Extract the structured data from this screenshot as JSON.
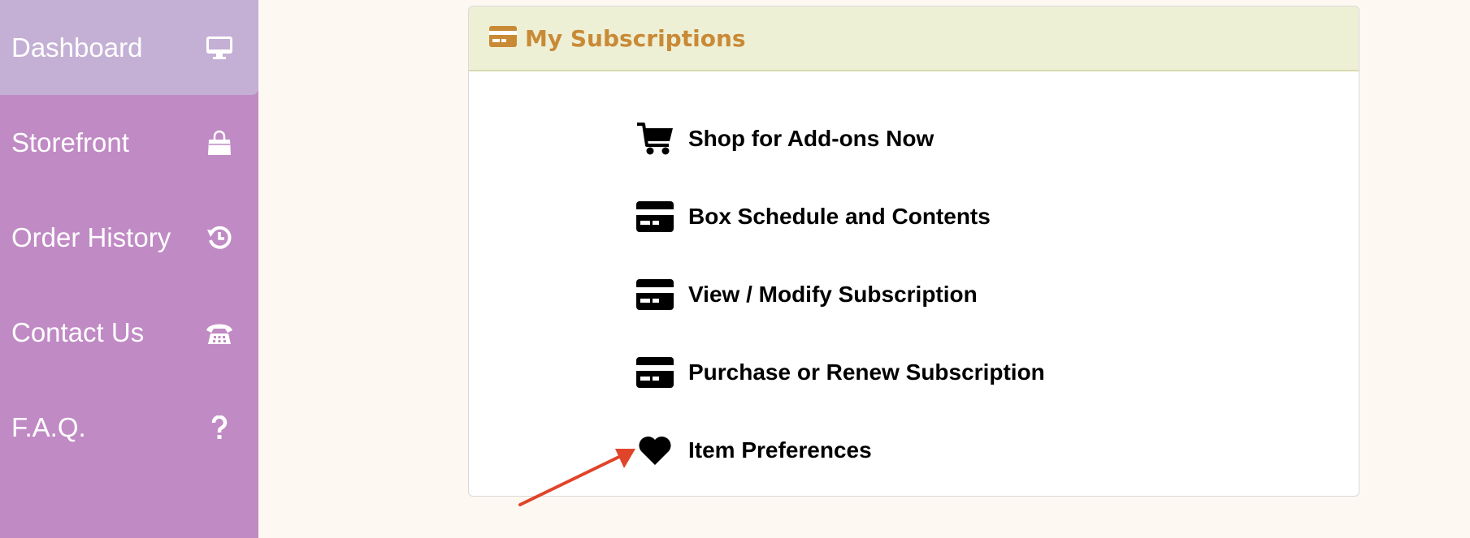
{
  "sidebar": {
    "items": [
      {
        "label": "Dashboard",
        "icon": "monitor-icon",
        "active": true
      },
      {
        "label": "Storefront",
        "icon": "shopping-bag-icon"
      },
      {
        "label": "Order History",
        "icon": "history-icon"
      },
      {
        "label": "Contact Us",
        "icon": "telephone-icon"
      },
      {
        "label": "F.A.Q.",
        "icon": "question-icon"
      }
    ]
  },
  "panel": {
    "title": "My Subscriptions",
    "title_icon": "credit-card-icon",
    "links": [
      {
        "label": "Shop for Add-ons Now",
        "icon": "shopping-cart-icon"
      },
      {
        "label": "Box Schedule and Contents",
        "icon": "credit-card-icon"
      },
      {
        "label": "View / Modify Subscription",
        "icon": "credit-card-icon"
      },
      {
        "label": "Purchase or Renew Subscription",
        "icon": "credit-card-icon"
      },
      {
        "label": "Item Preferences",
        "icon": "heart-icon"
      }
    ]
  },
  "colors": {
    "sidebar_bg": "#c08ac4",
    "sidebar_active": "#c4b0d4",
    "page_bg": "#fdf9f2",
    "panel_header_bg": "#eef0d6",
    "panel_title": "#c98a36",
    "annotation_arrow": "#e0442a"
  },
  "annotation": {
    "type": "arrow",
    "points_to": "Item Preferences"
  }
}
